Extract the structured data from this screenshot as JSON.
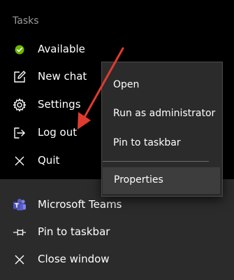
{
  "tasks": {
    "header": "Tasks",
    "items": [
      {
        "label": "Available",
        "icon": "status-available-icon"
      },
      {
        "label": "New chat",
        "icon": "new-chat-icon"
      },
      {
        "label": "Settings",
        "icon": "gear-icon"
      },
      {
        "label": "Log out",
        "icon": "log-out-icon"
      },
      {
        "label": "Quit",
        "icon": "close-icon"
      }
    ]
  },
  "context_menu": {
    "items": [
      {
        "label": "Open"
      },
      {
        "label": "Run as administrator"
      },
      {
        "label": "Pin to taskbar"
      },
      {
        "label": "Properties"
      }
    ],
    "selected": "Properties"
  },
  "jump_list": {
    "items": [
      {
        "label": "Microsoft Teams",
        "icon": "teams-icon"
      },
      {
        "label": "Pin to taskbar",
        "icon": "pin-icon"
      },
      {
        "label": "Close window",
        "icon": "close-icon"
      }
    ]
  },
  "colors": {
    "status_available": "#6bb700",
    "arrow": "#e03b2f",
    "teams_brand": "#5b5fc7"
  }
}
